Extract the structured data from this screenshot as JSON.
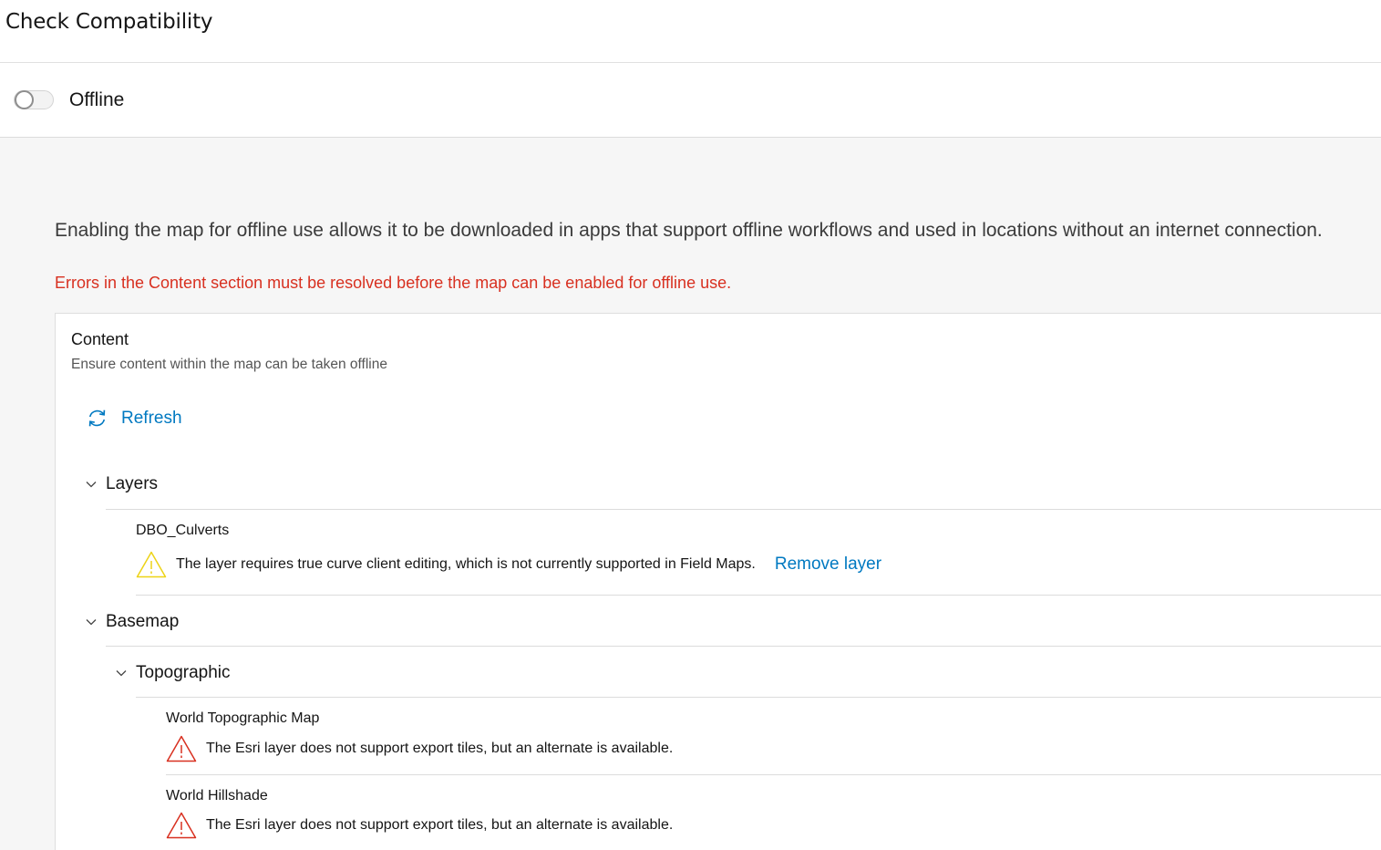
{
  "header": {
    "title": "Check Compatibility"
  },
  "offline_toggle": {
    "label": "Offline",
    "enabled": false
  },
  "main": {
    "intro": "Enabling the map for offline use allows it to be downloaded in apps that support offline workflows and used in locations without an internet connection.",
    "error": "Errors in the Content section must be resolved before the map can be enabled for offline use."
  },
  "content": {
    "title": "Content",
    "description": "Ensure content within the map can be taken offline",
    "refresh_label": "Refresh",
    "layers": {
      "label": "Layers",
      "items": [
        {
          "name": "DBO_Culverts",
          "severity": "warning",
          "message": "The layer requires true curve client editing, which is not currently supported in Field Maps.",
          "action": "Remove layer"
        }
      ]
    },
    "basemap": {
      "label": "Basemap",
      "groups": [
        {
          "label": "Topographic",
          "items": [
            {
              "name": "World Topographic Map",
              "severity": "error",
              "message": "The Esri layer does not support export tiles, but an alternate is available."
            },
            {
              "name": "World Hillshade",
              "severity": "error",
              "message": "The Esri layer does not support export tiles, but an alternate is available."
            }
          ]
        }
      ]
    }
  },
  "colors": {
    "link": "#0079c1",
    "error": "#d83020",
    "warning": "#edd317",
    "background": "#f6f6f6"
  },
  "icons": {
    "refresh": "refresh-icon",
    "chevron": "chevron-down-icon",
    "warning": "warning-triangle-icon",
    "error": "error-triangle-icon"
  }
}
